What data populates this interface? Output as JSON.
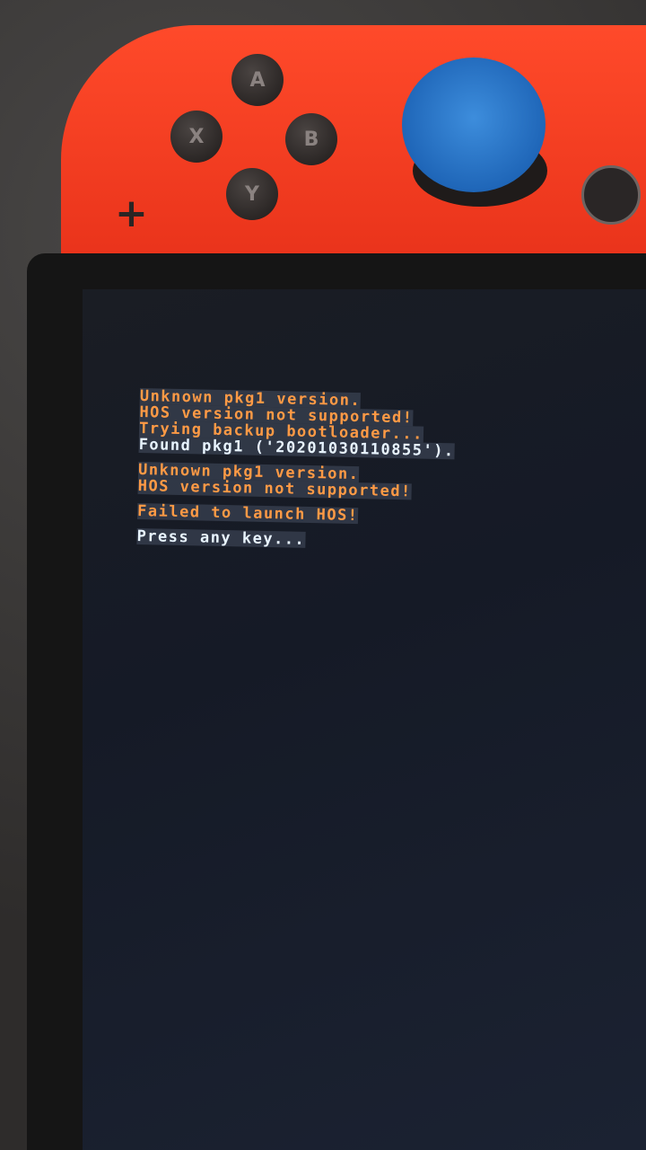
{
  "controller": {
    "buttons": {
      "a": "A",
      "b": "B",
      "x": "X",
      "y": "Y"
    },
    "plus": "+"
  },
  "screen": {
    "lines": [
      {
        "text": "Unknown pkg1 version.",
        "color": "#ff9a45"
      },
      {
        "text": "HOS version not supported!",
        "color": "#ff9a45"
      },
      {
        "text": "Trying backup bootloader...",
        "color": "#ff9a45"
      },
      {
        "text": "Found pkg1 ('20201030110855').",
        "color": "#e8f4ff"
      },
      {
        "text": "Unknown pkg1 version.",
        "color": "#ff9a45"
      },
      {
        "text": "HOS version not supported!",
        "color": "#ff9a45"
      },
      {
        "text": "Failed to launch HOS!",
        "color": "#ff9a45"
      },
      {
        "text": "Press any key...",
        "color": "#e8f4ff"
      }
    ]
  }
}
